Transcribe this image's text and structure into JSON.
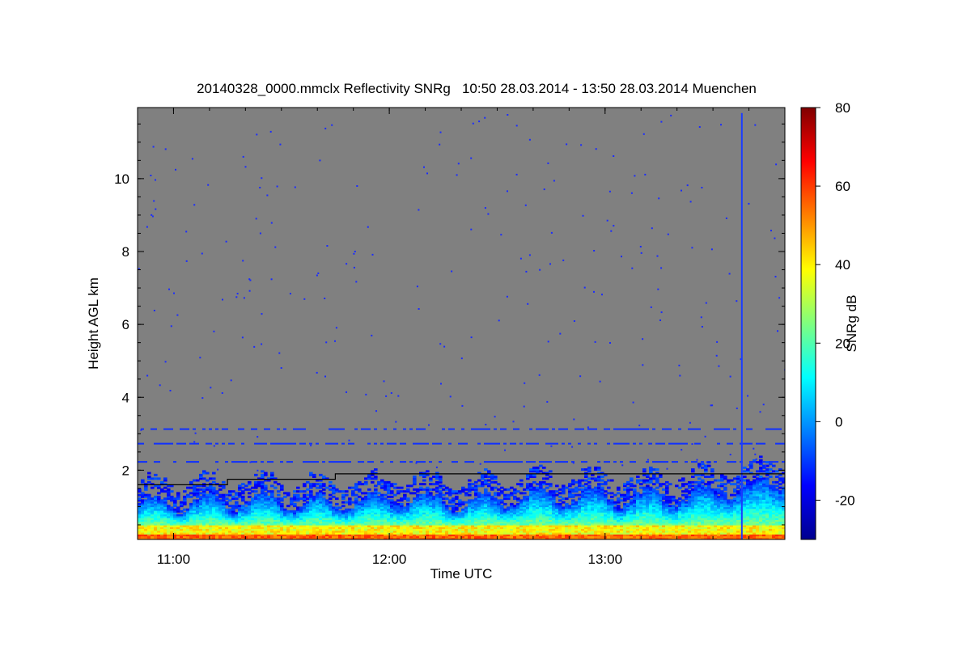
{
  "chart_data": {
    "type": "heatmap",
    "title": "20140328_0000.mmclx Reflectivity SNRg   10:50 28.03.2014 - 13:50 28.03.2014 Muenchen",
    "xlabel": "Time UTC",
    "ylabel": "Height AGL km",
    "colorbar_label": "SNRg dB",
    "x_range_utc": [
      "10:50",
      "13:50"
    ],
    "x_ticks": [
      {
        "value_h": 11.0,
        "label": "11:00"
      },
      {
        "value_h": 12.0,
        "label": "12:00"
      },
      {
        "value_h": 13.0,
        "label": "13:00"
      }
    ],
    "ylim_km": [
      0.1,
      11.95
    ],
    "y_ticks": [
      {
        "value": 2,
        "label": "2"
      },
      {
        "value": 4,
        "label": "4"
      },
      {
        "value": 6,
        "label": "6"
      },
      {
        "value": 8,
        "label": "8"
      },
      {
        "value": 10,
        "label": "10"
      }
    ],
    "colorbar_range_db": [
      -30,
      80
    ],
    "colorbar_ticks": [
      {
        "value": 80,
        "label": "80"
      },
      {
        "value": 60,
        "label": "60"
      },
      {
        "value": 40,
        "label": "40"
      },
      {
        "value": 20,
        "label": "20"
      },
      {
        "value": 0,
        "label": "0"
      },
      {
        "value": -20,
        "label": "-20"
      }
    ],
    "background_color": "#808080",
    "colormap": "jet",
    "boundary_layer_line_km": [
      {
        "time_h": 10.833,
        "height": 1.6
      },
      {
        "time_h": 11.25,
        "height": 1.6
      },
      {
        "time_h": 11.25,
        "height": 1.75
      },
      {
        "time_h": 11.75,
        "height": 1.75
      },
      {
        "time_h": 11.75,
        "height": 1.9
      },
      {
        "time_h": 13.833,
        "height": 1.9
      }
    ],
    "cloud_echo_top_km": [
      {
        "time_h": 10.85,
        "height": 1.0
      },
      {
        "time_h": 11.1,
        "height": 1.1
      },
      {
        "time_h": 11.45,
        "height": 1.15
      },
      {
        "time_h": 11.75,
        "height": 1.05
      },
      {
        "time_h": 12.05,
        "height": 1.2
      },
      {
        "time_h": 12.4,
        "height": 1.1
      },
      {
        "time_h": 12.75,
        "height": 1.3
      },
      {
        "time_h": 13.1,
        "height": 1.2
      },
      {
        "time_h": 13.4,
        "height": 1.3
      },
      {
        "time_h": 13.7,
        "height": 1.5
      },
      {
        "time_h": 13.83,
        "height": 1.7
      }
    ],
    "noise_layers_km": [
      3.15,
      2.75,
      2.25
    ],
    "grid": false
  }
}
